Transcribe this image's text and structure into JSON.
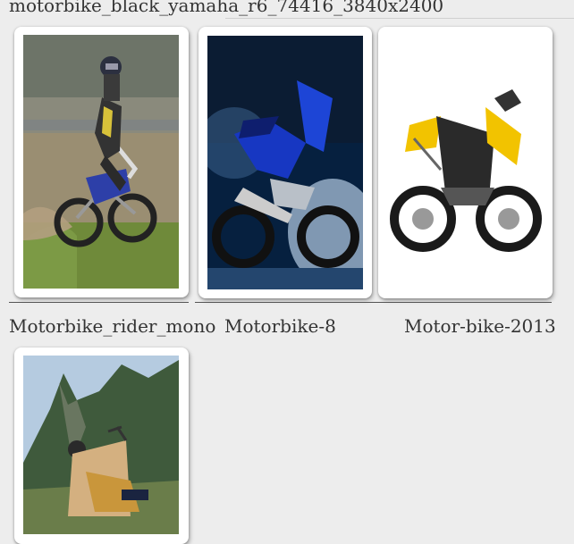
{
  "top_caption": "motorbike_black_yamaha_r6_74416_3840x2400",
  "gallery": {
    "items": [
      {
        "caption": "Motorbike_rider_mono",
        "image": "dirt-bike-rider-photo"
      },
      {
        "caption": "Motorbike-8",
        "image": "blue-sport-bike-photo"
      },
      {
        "caption": "Motor-bike-2013",
        "image": "yellow-electric-motorbike-photo"
      },
      {
        "caption": "",
        "image": "cruiser-motorbike-mountains-photo"
      }
    ]
  },
  "colors": {
    "background": "#ededed",
    "card": "#ffffff",
    "text": "#333333"
  }
}
